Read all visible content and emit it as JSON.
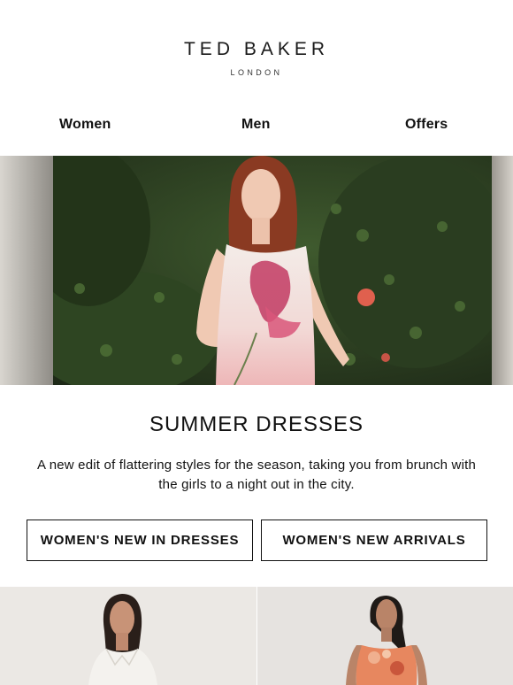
{
  "brand": {
    "name": "TED BAKER",
    "location": "LONDON"
  },
  "nav": {
    "items": [
      {
        "label": "Women"
      },
      {
        "label": "Men"
      },
      {
        "label": "Offers"
      }
    ]
  },
  "hero": {
    "icon": "hero-photo-woman-floral-dress"
  },
  "content": {
    "headline": "SUMMER DRESSES",
    "body": "A new edit of flattering styles for the season, taking you from brunch with the girls to a night out in the city."
  },
  "buttons": {
    "new_in_dresses": "WOMEN'S NEW IN DRESSES",
    "new_arrivals": "WOMEN'S NEW ARRIVALS"
  },
  "colors": {
    "text": "#111111",
    "background": "#ffffff",
    "border": "#111111"
  }
}
